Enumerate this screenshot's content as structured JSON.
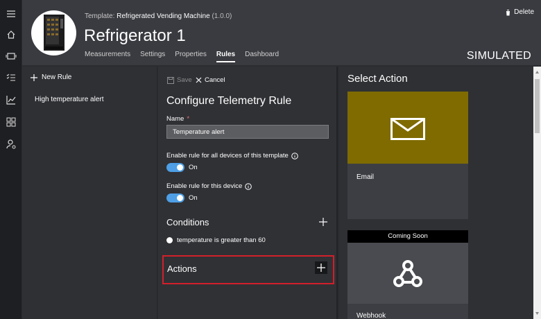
{
  "nav_rail": {
    "icons": [
      "hamburger-icon",
      "home-icon",
      "device-icon",
      "checklist-icon",
      "analytics-icon",
      "dashboard-icon",
      "user-settings-icon"
    ]
  },
  "header": {
    "template_label": "Template:",
    "template_name": "Refrigerated Vending Machine",
    "template_version": "(1.0.0)",
    "device_name": "Refrigerator 1",
    "tabs": [
      {
        "label": "Measurements",
        "active": false
      },
      {
        "label": "Settings",
        "active": false
      },
      {
        "label": "Properties",
        "active": false
      },
      {
        "label": "Rules",
        "active": true
      },
      {
        "label": "Dashboard",
        "active": false
      }
    ],
    "delete_label": "Delete",
    "status": "SIMULATED"
  },
  "rules_panel": {
    "new_rule_label": "New Rule",
    "rules": [
      "High temperature alert"
    ]
  },
  "config": {
    "save_label": "Save",
    "cancel_label": "Cancel",
    "title": "Configure Telemetry Rule",
    "name_label": "Name",
    "name_required_mark": "*",
    "name_value": "Temperature alert",
    "enable_all_label": "Enable rule for all devices of this template",
    "enable_all_state": "On",
    "enable_device_label": "Enable rule for this device",
    "enable_device_state": "On",
    "conditions_title": "Conditions",
    "conditions": [
      "temperature is greater than 60"
    ],
    "actions_title": "Actions"
  },
  "select_action": {
    "title": "Select Action",
    "cards": [
      {
        "label": "Email",
        "icon": "envelope-icon",
        "color": "#7f6b00"
      },
      {
        "label": "Webhook",
        "icon": "webhook-icon",
        "badge": "Coming Soon"
      }
    ]
  },
  "colors": {
    "accent_toggle": "#4e9fe5",
    "highlight_border": "#d21f2a",
    "background": "#2b2c30"
  }
}
